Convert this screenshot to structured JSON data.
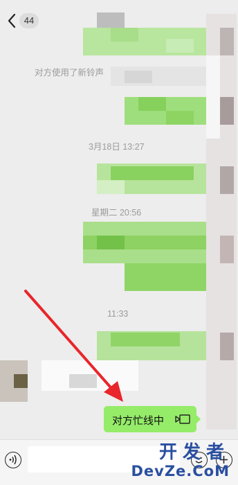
{
  "header": {
    "unread_count": "44",
    "back_icon": "chevron-left-icon",
    "more_icon": "more-dots-icon"
  },
  "messages": {
    "system_ringtone": "对方使用了新铃声",
    "time_1": "3月18日 13:27",
    "time_2": "星期二 20:56",
    "time_3": "11:33",
    "call_status": "对方忙线中"
  },
  "bubble_icon": "video-call-icon",
  "input_bar": {
    "voice_icon": "voice-icon",
    "emoji_icon": "emoji-icon",
    "plus_icon": "plus-icon"
  },
  "watermark": {
    "line1": "开发者",
    "line2": "DevZe.CoM"
  },
  "colors": {
    "background": "#ededed",
    "bubble_green": "#95ec69",
    "arrow_red": "#e8262b",
    "watermark_blue": "#2a4fa0"
  }
}
